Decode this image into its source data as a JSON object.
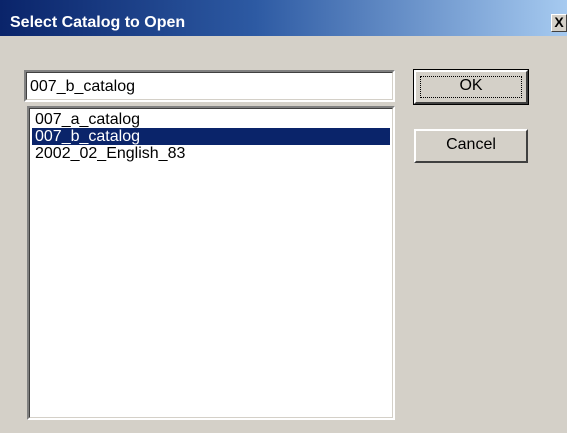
{
  "window": {
    "title": "Select Catalog to Open",
    "close_glyph": "X"
  },
  "catalog_input": {
    "value": "007_b_catalog"
  },
  "catalog_list": {
    "items": [
      {
        "label": "007_a_catalog",
        "selected": false
      },
      {
        "label": "007_b_catalog",
        "selected": true
      },
      {
        "label": "2002_02_English_83",
        "selected": false
      }
    ]
  },
  "buttons": {
    "ok_label": "OK",
    "cancel_label": "Cancel"
  },
  "colors": {
    "face": "#d4d0c8",
    "title_active": "#0a246a",
    "selection": "#0a246a"
  }
}
